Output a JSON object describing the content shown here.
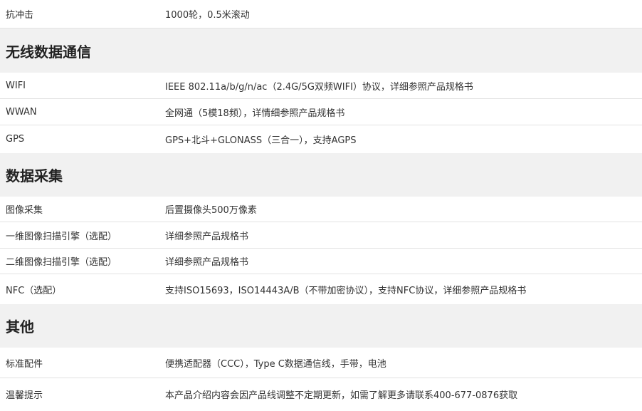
{
  "rows_top": [
    {
      "key": "抗冲击",
      "value": "1000轮，0.5米滚动"
    }
  ],
  "sections": [
    {
      "title": "无线数据通信",
      "rows": [
        {
          "key": "WIFI",
          "value": "IEEE 802.11a/b/g/n/ac（2.4G/5G双频WIFI）协议，详细参照产品规格书"
        },
        {
          "key": "WWAN",
          "value": "全网通（5模18频），详情细参照产品规格书"
        },
        {
          "key": "GPS",
          "value": "GPS+北斗+GLONASS（三合一），支持AGPS"
        }
      ]
    },
    {
      "title": "数据采集",
      "rows": [
        {
          "key": "图像采集",
          "value": "后置摄像头500万像素"
        },
        {
          "key": "一维图像扫描引擎（选配）",
          "value": "详细参照产品规格书"
        },
        {
          "key": "二维图像扫描引擎（选配）",
          "value": "详细参照产品规格书"
        },
        {
          "key": "NFC（选配）",
          "value": "支持ISO15693，ISO14443A/B（不带加密协议），支持NFC协议，详细参照产品规格书"
        }
      ]
    },
    {
      "title": "其他",
      "rows": [
        {
          "key": "标准配件",
          "value": "便携适配器（CCC），Type C数据通信线，手带，电池"
        },
        {
          "key": "温馨提示",
          "value": "本产品介绍内容会因产品线调整不定期更新，如需了解更多请联系400-677-0876获取"
        }
      ]
    }
  ]
}
